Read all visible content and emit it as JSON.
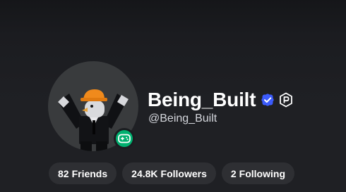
{
  "profile": {
    "display_name": "Being_Built",
    "username": "@Being_Built",
    "verified": true,
    "premium": true,
    "presence": "in-game",
    "colors": {
      "verified": "#3b5bfc",
      "presence": "#00b06f",
      "pill_bg": "#2e2f33"
    }
  },
  "stats": [
    {
      "count": "82",
      "label": "Friends"
    },
    {
      "count": "24.8K",
      "label": "Followers"
    },
    {
      "count": "2",
      "label": "Following"
    }
  ],
  "icons": {
    "verified": "verified-badge-icon",
    "premium": "premium-icon",
    "presence": "gamepad-icon"
  }
}
